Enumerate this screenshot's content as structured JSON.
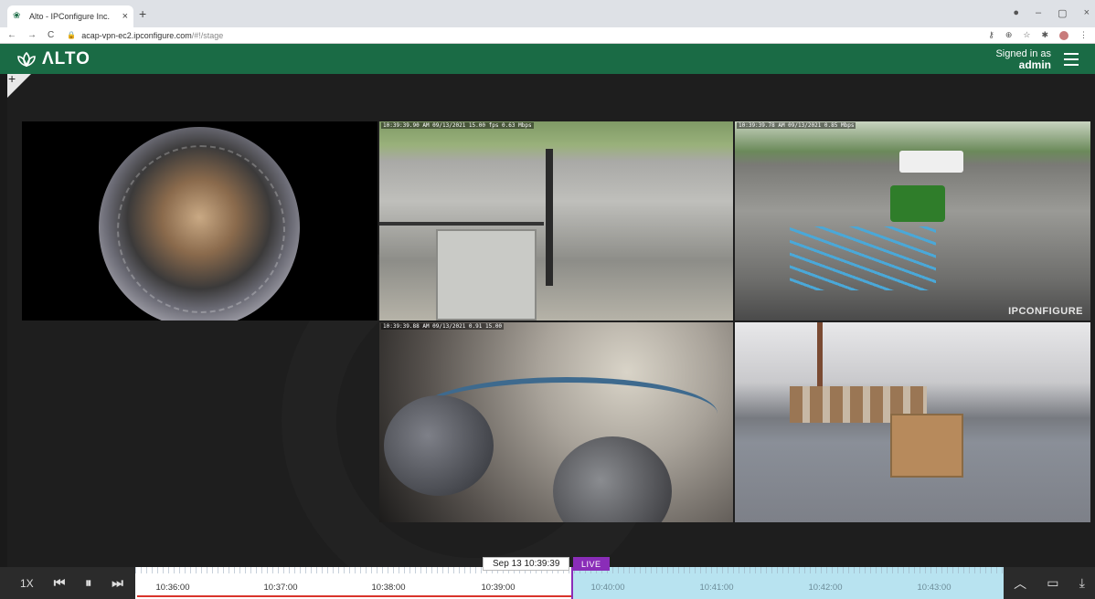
{
  "browser": {
    "tab_title": "Alto - IPConfigure Inc.",
    "tab_close": "×",
    "new_tab": "+",
    "nav_back": "←",
    "nav_forward": "→",
    "nav_reload": "C",
    "url_host": "acap-vpn-ec2.ipconfigure.com",
    "url_path": "/#!/stage",
    "window_min": "–",
    "window_max": "▢",
    "window_close": "×"
  },
  "app": {
    "logo_text": "ΛLTO",
    "signed_in_label": "Signed in as",
    "username": "admin",
    "brand_color": "#1a6b45"
  },
  "stage": {
    "add_label": "+",
    "tiles": [
      {
        "name": "fisheye-camera",
        "overlay": ""
      },
      {
        "name": "parking-lot-camera-1",
        "overlay": "10:39:39.90 AM 09/13/2021 15.00 fps  0.63 Mbps"
      },
      {
        "name": "parking-lot-camera-2",
        "overlay": "10:39:39.78 AM 09/13/2021  0.85 Mbps",
        "watermark": "IPCONFIGURE"
      },
      {
        "name": "closeup-camera",
        "overlay": "10:39:39.88 AM 09/13/2021  0.91 15.00"
      },
      {
        "name": "warehouse-camera",
        "overlay": ""
      }
    ]
  },
  "timeline": {
    "speed": "1X",
    "cursor_time": "Sep 13 10:39:39",
    "live_label": "LIVE",
    "labels": [
      "10:36:00",
      "10:37:00",
      "10:38:00",
      "10:39:00",
      "10:40:00",
      "10:41:00",
      "10:42:00",
      "10:43:00"
    ],
    "recorded_color": "#d9342b",
    "live_color": "#8a2db8",
    "future_color": "#b8e3f0"
  }
}
